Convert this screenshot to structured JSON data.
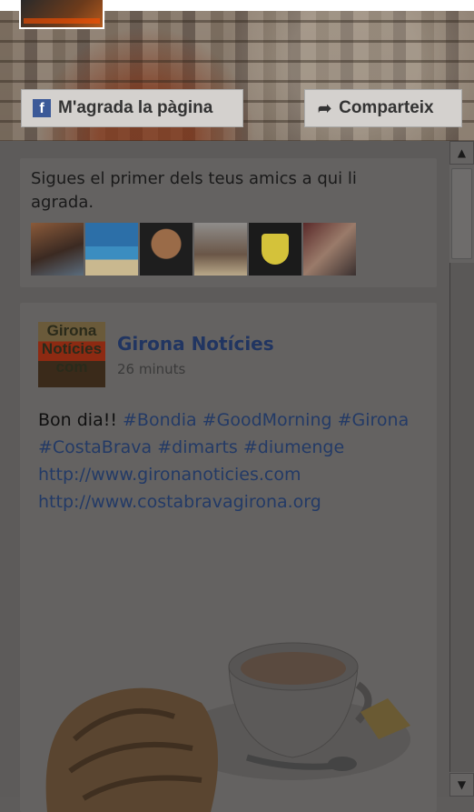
{
  "header": {
    "like_button": {
      "label": "M'agrada la pàgina",
      "icon": "facebook-f-icon"
    },
    "share_button": {
      "label": "Comparteix",
      "icon": "share-arrow-icon"
    }
  },
  "friends": {
    "text": "Sigues el primer dels teus amics a qui li agrada."
  },
  "post": {
    "page_name": "Girona Notícies",
    "time": "26 minuts",
    "avatar_text": "Girona Notícies com",
    "body_lead": "Bon dia!!",
    "hashtags": [
      "#Bondia",
      "#GoodMorning",
      "#Girona",
      "#CostaBrava",
      "#dimarts",
      "#diumenge"
    ],
    "links": [
      "http://www.gironanoticies.com",
      "http://www.costabravagirona.org"
    ]
  },
  "colors": {
    "link": "#233a66",
    "facebook_blue": "#3b5998",
    "overlay_bg": "#5d5b5a"
  }
}
